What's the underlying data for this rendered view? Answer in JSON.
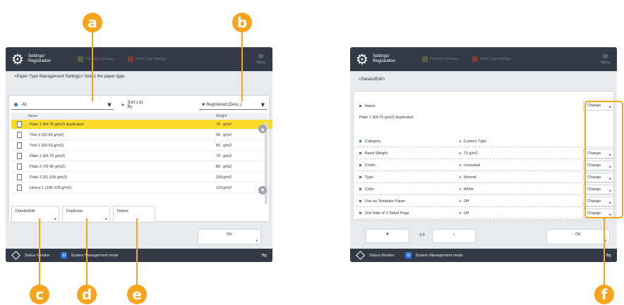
{
  "colors": {
    "callout": "#f5a41c",
    "topbar": "#343a45",
    "selected_row": "#fbdc2b",
    "accent": "#2f73d6",
    "panel_bg": "#e9eaee"
  },
  "callouts": {
    "a": "a",
    "b": "b",
    "c": "c",
    "d": "d",
    "e": "e",
    "f": "f"
  },
  "left": {
    "header": {
      "title": "Settings/ Registration",
      "ghost1": "Favorites Settings",
      "ghost2": "Desk Copy Settings",
      "menu": "Menu",
      "menu_icon": "hamburger-icon"
    },
    "heading": "<Paper Type Management Settings> Select the paper type.",
    "filter": {
      "value": "All"
    },
    "sort": {
      "label": "Sort List By",
      "value": "Registered (Desc.)"
    },
    "list": {
      "columns": [
        "Name",
        "Weight"
      ],
      "rows": [
        {
          "name": "Plain 1 (64-75 g/m2) duplicated",
          "weight": "70",
          "unit": "g/m2",
          "selected": true
        },
        {
          "name": "Thin 2 (52-59 g/m2)",
          "weight": "55",
          "unit": "g/m2"
        },
        {
          "name": "Thin 1 (60-63 g/m2)",
          "weight": "60",
          "unit": "g/m2"
        },
        {
          "name": "Plain 1 (64-75 g/m2)",
          "weight": "70",
          "unit": "g/m2"
        },
        {
          "name": "Plain 2 (76-90 g/m2)",
          "weight": "80",
          "unit": "g/m2"
        },
        {
          "name": "Plain 3 (91-105 g/m2)",
          "weight": "100",
          "unit": "g/m2"
        },
        {
          "name": "Heavy 1 (106-128 g/m2)",
          "weight": "110",
          "unit": "g/m2"
        }
      ]
    },
    "buttons": {
      "details": "Details/Edit",
      "duplicate": "Duplicate",
      "delete": "Delete",
      "ok": "OK"
    },
    "status": {
      "monitor": "Status Monitor",
      "mode": "System Management mode"
    }
  },
  "right": {
    "header": {
      "title": "Settings/ Registration",
      "ghost1": "Favorites Settings",
      "ghost2": "Desk Copy Settings",
      "menu": "Menu"
    },
    "heading": "<Details/Edit>",
    "name_label": "Name",
    "name_value": "Plain 1 (64-75 g/m2) duplicated",
    "change": "Change",
    "attributes": [
      {
        "label": "Category",
        "value": "Custom Type",
        "changeable": false
      },
      {
        "label": "Basis Weight",
        "value": "70 g/m2",
        "changeable": true
      },
      {
        "label": "Finish",
        "value": "Uncoated",
        "changeable": true
      },
      {
        "label": "Type",
        "value": "Normal",
        "changeable": true
      },
      {
        "label": "Color",
        "value": "White",
        "changeable": true
      },
      {
        "label": "Use as Template Paper",
        "value": "Off",
        "changeable": true
      },
      {
        "label": "2nd Side of 2-Sided Page",
        "value": "Off",
        "changeable": true
      }
    ],
    "pager": {
      "page": "1/2",
      "down": "▼",
      "up": "▲"
    },
    "ok": "OK",
    "status": {
      "monitor": "Status Monitor",
      "mode": "System Management mode"
    }
  }
}
